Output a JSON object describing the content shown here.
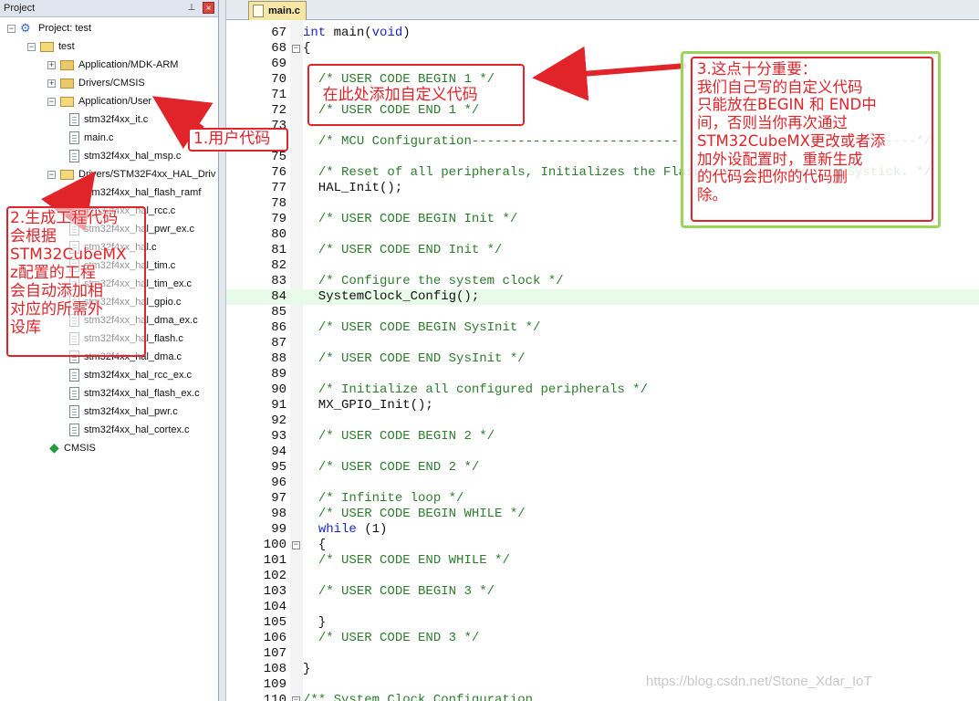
{
  "project_panel": {
    "title": "Project",
    "pin_glyph": "⊥",
    "close_glyph": "×",
    "tree": [
      {
        "id": "root",
        "label": "Project: test",
        "kind": "project",
        "expanded": true
      },
      {
        "id": "target",
        "label": "test",
        "kind": "target",
        "expanded": true
      },
      {
        "id": "g1",
        "label": "Application/MDK-ARM",
        "kind": "folder",
        "expanded": false
      },
      {
        "id": "g2",
        "label": "Drivers/CMSIS",
        "kind": "folder",
        "expanded": false
      },
      {
        "id": "g3",
        "label": "Application/User",
        "kind": "folder",
        "expanded": true
      },
      {
        "id": "f1",
        "label": "stm32f4xx_it.c",
        "kind": "file"
      },
      {
        "id": "f2",
        "label": "main.c",
        "kind": "file"
      },
      {
        "id": "f3",
        "label": "stm32f4xx_hal_msp.c",
        "kind": "file"
      },
      {
        "id": "g4",
        "label": "Drivers/STM32F4xx_HAL_Driv",
        "kind": "folder",
        "expanded": true
      },
      {
        "id": "f4",
        "label": "stm32f4xx_hal_flash_ramf",
        "kind": "file"
      },
      {
        "id": "f5",
        "label": "stm32f4xx_hal_rcc.c",
        "kind": "file"
      },
      {
        "id": "f6",
        "label": "stm32f4xx_hal_pwr_ex.c",
        "kind": "file"
      },
      {
        "id": "f7",
        "label": "stm32f4xx_hal.c",
        "kind": "file"
      },
      {
        "id": "f8",
        "label": "stm32f4xx_hal_tim.c",
        "kind": "file"
      },
      {
        "id": "f9",
        "label": "stm32f4xx_hal_tim_ex.c",
        "kind": "file"
      },
      {
        "id": "f10",
        "label": "stm32f4xx_hal_gpio.c",
        "kind": "file"
      },
      {
        "id": "f11",
        "label": "stm32f4xx_hal_dma_ex.c",
        "kind": "file"
      },
      {
        "id": "f12",
        "label": "stm32f4xx_hal_flash.c",
        "kind": "file"
      },
      {
        "id": "f13",
        "label": "stm32f4xx_hal_dma.c",
        "kind": "file"
      },
      {
        "id": "f14",
        "label": "stm32f4xx_hal_rcc_ex.c",
        "kind": "file"
      },
      {
        "id": "f15",
        "label": "stm32f4xx_hal_flash_ex.c",
        "kind": "file"
      },
      {
        "id": "f16",
        "label": "stm32f4xx_hal_pwr.c",
        "kind": "file"
      },
      {
        "id": "f17",
        "label": "stm32f4xx_hal_cortex.c",
        "kind": "file"
      },
      {
        "id": "cmsis",
        "label": "CMSIS",
        "kind": "component"
      }
    ]
  },
  "editor": {
    "active_tab": "main.c",
    "current_line": 84,
    "lines": [
      {
        "n": "67",
        "text": "int main(void)"
      },
      {
        "n": "68",
        "text": "{"
      },
      {
        "n": "69",
        "text": ""
      },
      {
        "n": "70",
        "text": "  /* USER CODE BEGIN 1 */"
      },
      {
        "n": "71",
        "text": "    在此处添加自定义代码"
      },
      {
        "n": "72",
        "text": "  /* USER CODE END 1 */"
      },
      {
        "n": "73",
        "text": ""
      },
      {
        "n": "74",
        "text": "  /* MCU Configuration----------------------------------------------------------*/"
      },
      {
        "n": "75",
        "text": ""
      },
      {
        "n": "76",
        "text": "  /* Reset of all peripherals, Initializes the Flash interface and the Systick. */"
      },
      {
        "n": "77",
        "text": "  HAL_Init();"
      },
      {
        "n": "78",
        "text": ""
      },
      {
        "n": "79",
        "text": "  /* USER CODE BEGIN Init */"
      },
      {
        "n": "80",
        "text": ""
      },
      {
        "n": "81",
        "text": "  /* USER CODE END Init */"
      },
      {
        "n": "82",
        "text": ""
      },
      {
        "n": "83",
        "text": "  /* Configure the system clock */"
      },
      {
        "n": "84",
        "text": "  SystemClock_Config();"
      },
      {
        "n": "85",
        "text": ""
      },
      {
        "n": "86",
        "text": "  /* USER CODE BEGIN SysInit */"
      },
      {
        "n": "87",
        "text": ""
      },
      {
        "n": "88",
        "text": "  /* USER CODE END SysInit */"
      },
      {
        "n": "89",
        "text": ""
      },
      {
        "n": "90",
        "text": "  /* Initialize all configured peripherals */"
      },
      {
        "n": "91",
        "text": "  MX_GPIO_Init();"
      },
      {
        "n": "92",
        "text": ""
      },
      {
        "n": "93",
        "text": "  /* USER CODE BEGIN 2 */"
      },
      {
        "n": "94",
        "text": ""
      },
      {
        "n": "95",
        "text": "  /* USER CODE END 2 */"
      },
      {
        "n": "96",
        "text": ""
      },
      {
        "n": "97",
        "text": "  /* Infinite loop */"
      },
      {
        "n": "98",
        "text": "  /* USER CODE BEGIN WHILE */"
      },
      {
        "n": "99",
        "text": "  while (1)"
      },
      {
        "n": "100",
        "text": "  {"
      },
      {
        "n": "101",
        "text": "  /* USER CODE END WHILE */"
      },
      {
        "n": "102",
        "text": ""
      },
      {
        "n": "103",
        "text": "  /* USER CODE BEGIN 3 */"
      },
      {
        "n": "104",
        "text": ""
      },
      {
        "n": "105",
        "text": "  }"
      },
      {
        "n": "106",
        "text": "  /* USER CODE END 3 */"
      },
      {
        "n": "107",
        "text": ""
      },
      {
        "n": "108",
        "text": "}"
      },
      {
        "n": "109",
        "text": ""
      },
      {
        "n": "110",
        "text": "/** System Clock Configuration"
      }
    ]
  },
  "annotations": {
    "note1": "1.用户代码",
    "note2": [
      "2.生成工程代码",
      "会根据",
      "STM32CubeMX",
      "z配置的工程",
      "会自动添加相",
      "对应的所需外",
      "设库"
    ],
    "note3": [
      "3.这点十分重要：",
      "我们自己写的自定义代码",
      "只能放在BEGIN 和 END中",
      "间，否则当你再次通过",
      "STM32CubeMX更改或者添",
      "加外设配置时，重新生成",
      "的代码会把你的代码删",
      "除。"
    ],
    "arrow_color": "#e0242a",
    "highlight_color": "#9bd45a"
  },
  "watermark": "https://blog.csdn.net/Stone_Xdar_IoT"
}
